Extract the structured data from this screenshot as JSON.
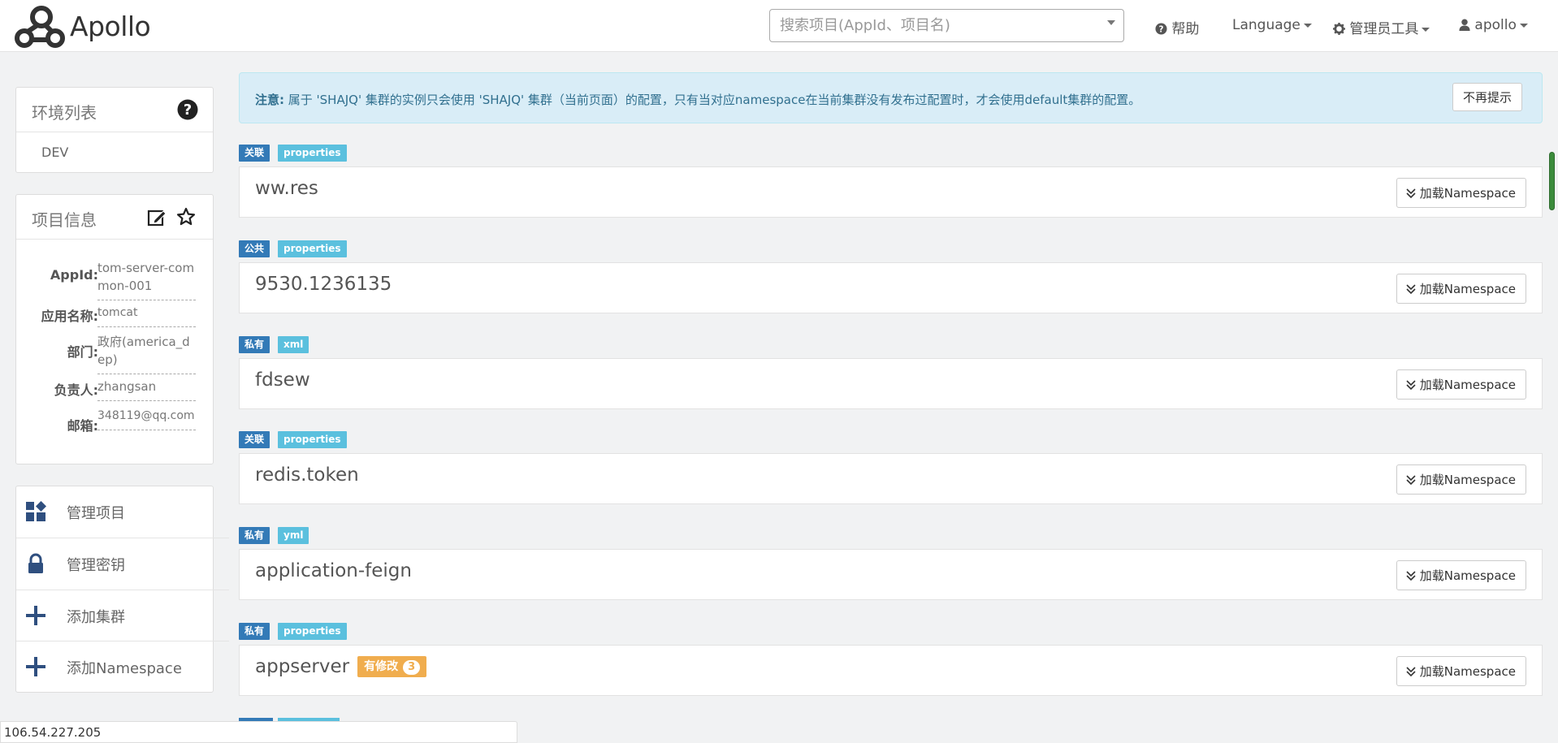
{
  "header": {
    "brand": "Apollo",
    "search_placeholder": "搜索项目(AppId、项目名)",
    "help": "帮助",
    "language": "Language",
    "admin_tools": "管理员工具",
    "user": "apollo"
  },
  "env_panel": {
    "title": "环境列表",
    "items": [
      "DEV"
    ]
  },
  "project_info": {
    "title": "项目信息",
    "rows": [
      {
        "label": "AppId:",
        "value": "tom-server-common-001"
      },
      {
        "label": "应用名称:",
        "value": "tomcat"
      },
      {
        "label": "部门:",
        "value": "政府(america_dep)"
      },
      {
        "label": "负责人:",
        "value": "zhangsan"
      },
      {
        "label": "邮箱:",
        "value": "348119@qq.com"
      }
    ]
  },
  "actions": [
    {
      "label": "管理项目",
      "icon": "dashboard-icon"
    },
    {
      "label": "管理密钥",
      "icon": "lock-icon"
    },
    {
      "label": "添加集群",
      "icon": "plus-icon"
    },
    {
      "label": "添加Namespace",
      "icon": "plus-icon"
    }
  ],
  "notice": {
    "prefix": "注意:",
    "text": " 属于 'SHAJQ' 集群的实例只会使用 'SHAJQ' 集群（当前页面）的配置，只有当对应namespace在当前集群没有发布过配置时，才会使用default集群的配置。",
    "dismiss": "不再提示"
  },
  "namespaces": [
    {
      "type": "关联",
      "format": "properties",
      "name": "ww.res",
      "action": "加载Namespace"
    },
    {
      "type": "公共",
      "format": "properties",
      "name": "9530.1236135",
      "action": "加载Namespace"
    },
    {
      "type": "私有",
      "format": "xml",
      "name": "fdsew",
      "action": "加载Namespace"
    },
    {
      "type": "关联",
      "format": "properties",
      "name": "redis.token",
      "action": "加载Namespace"
    },
    {
      "type": "私有",
      "format": "yml",
      "name": "application-feign",
      "action": "加载Namespace"
    },
    {
      "type": "私有",
      "format": "properties",
      "name": "appserver",
      "action": "加载Namespace",
      "modified_label": "有修改",
      "modified_count": "3"
    }
  ],
  "status_bar": "106.54.227.205",
  "colors": {
    "tag_type": "#337ab7",
    "tag_format": "#5bc0de",
    "modified": "#f0ad4e",
    "notice_bg": "#d9edf7"
  }
}
